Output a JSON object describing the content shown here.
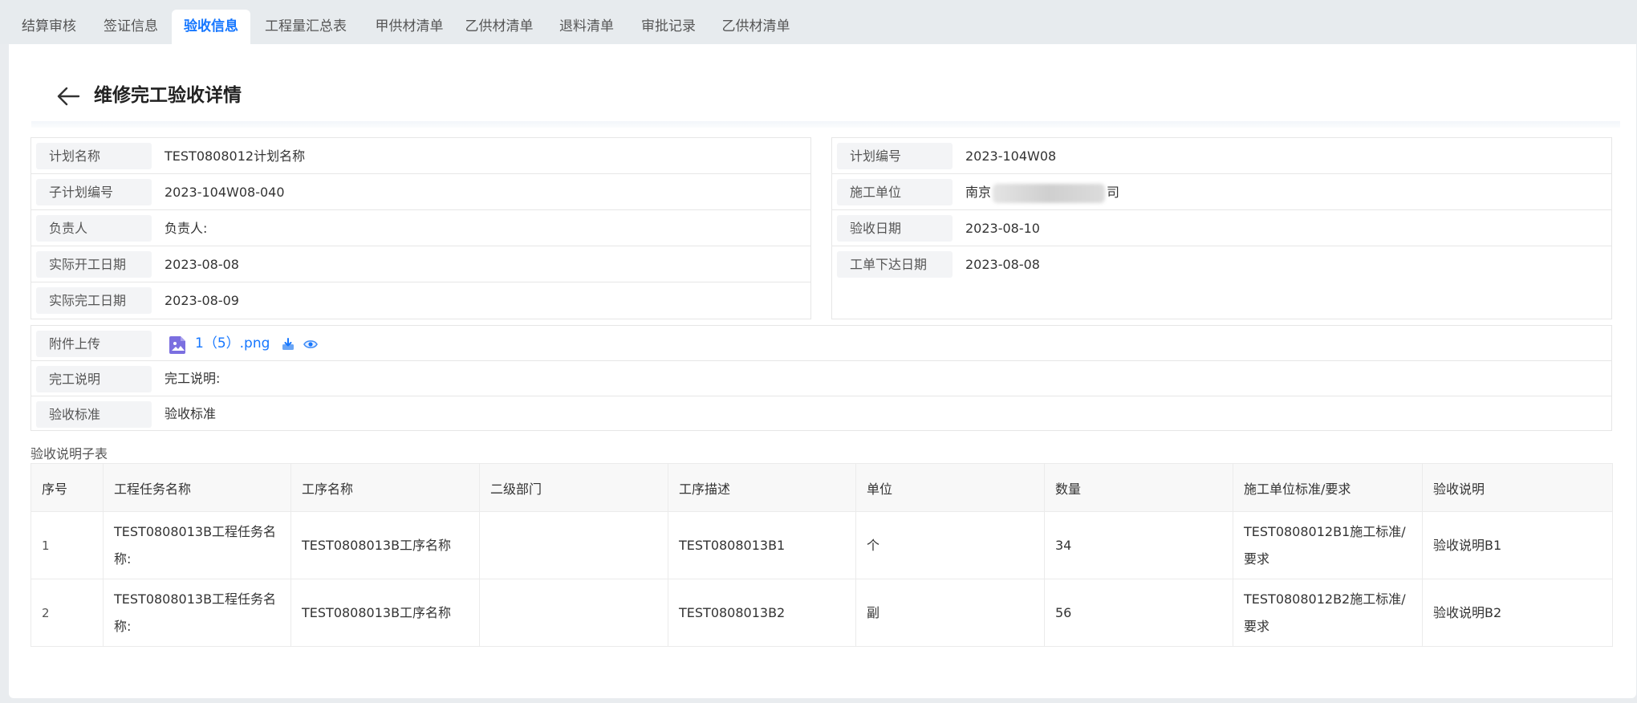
{
  "tabs": [
    {
      "label": "结算审核",
      "active": false
    },
    {
      "label": "签证信息",
      "active": false
    },
    {
      "label": "验收信息",
      "active": true
    },
    {
      "label": "工程量汇总表",
      "active": false
    },
    {
      "label": "甲供材清单",
      "active": false
    },
    {
      "label": "乙供材清单",
      "active": false
    },
    {
      "label": "退料清单",
      "active": false
    },
    {
      "label": "审批记录",
      "active": false
    },
    {
      "label": "乙供材清单",
      "active": false
    }
  ],
  "header": {
    "title": "维修完工验收详情",
    "back_icon": "arrow-left-icon"
  },
  "info_left": [
    {
      "label": "计划名称",
      "value": "TEST0808012计划名称"
    },
    {
      "label": "子计划编号",
      "value": "2023-104W08-040"
    },
    {
      "label": "负责人",
      "value": "负责人:"
    },
    {
      "label": "实际开工日期",
      "value": "2023-08-08"
    },
    {
      "label": "实际完工日期",
      "value": "2023-08-09"
    }
  ],
  "info_right": [
    {
      "label": "计划编号",
      "value": "2023-104W08"
    },
    {
      "label": "施工单位",
      "value_prefix": "南京",
      "value_suffix": "司"
    },
    {
      "label": "验收日期",
      "value": "2023-08-10"
    },
    {
      "label": "工单下达日期",
      "value": "2023-08-08"
    }
  ],
  "attachment": {
    "label": "附件上传",
    "file_name": "1（5）.png",
    "file_icon": "image-file-icon",
    "download_icon": "download-icon",
    "preview_icon": "eye-icon"
  },
  "completion": {
    "label": "完工说明",
    "value": "完工说明:"
  },
  "standard": {
    "label": "验收标准",
    "value": "验收标准"
  },
  "subtable": {
    "title": "验收说明子表",
    "columns": [
      "序号",
      "工程任务名称",
      "工序名称",
      "二级部门",
      "工序描述",
      "单位",
      "数量",
      "施工单位标准/要求",
      "验收说明"
    ],
    "rows": [
      [
        "1",
        "TEST0808013B工程任务名称:",
        "TEST0808013B工序名称",
        "",
        "TEST0808013B1",
        "个",
        "34",
        "TEST0808012B1施工标准/要求",
        "验收说明B1"
      ],
      [
        "2",
        "TEST0808013B工程任务名称:",
        "TEST0808013B工序名称",
        "",
        "TEST0808013B2",
        "副",
        "56",
        "TEST0808012B2施工标准/要求",
        "验收说明B2"
      ]
    ]
  },
  "colors": {
    "accent": "#1677ff",
    "label_bg": "#f3f4f6",
    "page_bg": "#e9ecef",
    "file_icon": "#7b6fe0"
  }
}
